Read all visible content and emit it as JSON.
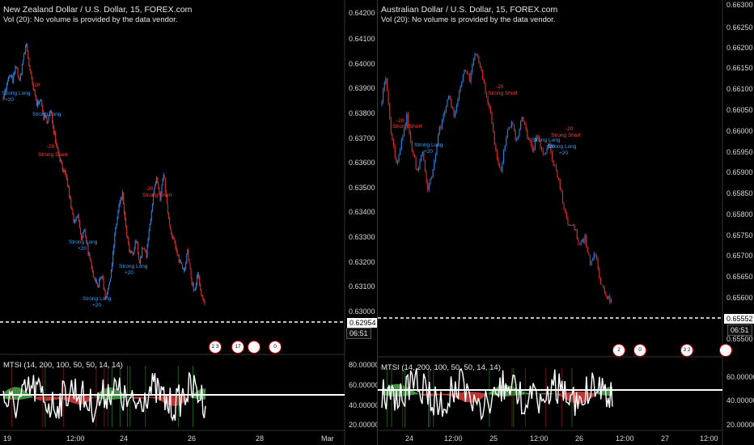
{
  "left": {
    "symbol": "New Zealand Dollar / U.S. Dollar, 15, FOREX.com",
    "volume_note": "Vol (20): No volume is provided by the data vendor.",
    "price_axis": [
      "0.64200",
      "0.64100",
      "0.64000",
      "0.63900",
      "0.63800",
      "0.63700",
      "0.63600",
      "0.63500",
      "0.63400",
      "0.63300",
      "0.63200",
      "0.63100",
      "0.63000"
    ],
    "price_axis_extra": "0",
    "current_price": "0.62954",
    "countdown": "06:51",
    "indicator_title": "MTSI (14, 200, 100, 50, 50, 14, 14)",
    "indicator_axis": [
      "80.00000",
      "60.00000",
      "40.00000",
      "20.00000"
    ],
    "indicator_axis_last": "80.00000",
    "time_axis": [
      "19",
      "12:00",
      "24",
      "26",
      "28",
      "Mar"
    ],
    "events": [
      "2 3",
      "17",
      "",
      "0"
    ],
    "annotations": [
      {
        "text": "-20",
        "kind": "short"
      },
      {
        "text": "Strong Long",
        "kind": "long"
      },
      {
        "text": "+20",
        "kind": "long"
      },
      {
        "text": "Strong Long",
        "kind": "long"
      },
      {
        "text": "-20",
        "kind": "short"
      },
      {
        "text": "Strong Short",
        "kind": "short"
      },
      {
        "text": "-20",
        "kind": "short"
      },
      {
        "text": "Strong Short",
        "kind": "short"
      },
      {
        "text": "Strong Long",
        "kind": "long"
      },
      {
        "text": "+20",
        "kind": "long"
      },
      {
        "text": "Strong Long",
        "kind": "long"
      },
      {
        "text": "+20",
        "kind": "long"
      },
      {
        "text": "Strong Long",
        "kind": "long"
      },
      {
        "text": "+20",
        "kind": "long"
      }
    ]
  },
  "right": {
    "symbol": "Australian Dollar / U.S. Dollar, 15, FOREX.com",
    "volume_note": "Vol (20): No volume is provided by the data vendor.",
    "price_axis": [
      "0.66300",
      "0.66250",
      "0.66200",
      "0.66150",
      "0.66100",
      "0.66050",
      "0.66000",
      "0.65950",
      "0.65900",
      "0.65850",
      "0.65800",
      "0.65750",
      "0.65700",
      "0.65650",
      "0.65600",
      "0.65500"
    ],
    "current_price": "0.65552",
    "countdown": "06:51",
    "indicator_title": "MTSI (14, 200, 100, 50, 50, 14, 14)",
    "indicator_axis": [
      "60.00000",
      "40.00000",
      "20.00000"
    ],
    "time_axis": [
      "24",
      "12:00",
      "25",
      "12:00",
      "26",
      "12:00",
      "27",
      "12:00"
    ],
    "events": [
      "2",
      "0",
      "3 2",
      ""
    ],
    "annotations": [
      {
        "text": "-20",
        "kind": "short"
      },
      {
        "text": "Strong Short",
        "kind": "short"
      },
      {
        "text": "Strong Long",
        "kind": "long"
      },
      {
        "text": "+20",
        "kind": "long"
      },
      {
        "text": "-20",
        "kind": "short"
      },
      {
        "text": "Strong Short",
        "kind": "short"
      },
      {
        "text": "-20",
        "kind": "short"
      },
      {
        "text": "Strong Short",
        "kind": "short"
      },
      {
        "text": "Strong Long",
        "kind": "long"
      },
      {
        "text": "+20",
        "kind": "long"
      },
      {
        "text": "Strong Long",
        "kind": "long"
      },
      {
        "text": "+20",
        "kind": "long"
      }
    ]
  },
  "colors": {
    "up": "#2f7fd9",
    "down": "#d23030",
    "bull_fill": "#4caf50",
    "bear_fill": "#e04040",
    "line": "#ffffff",
    "axis_bg": "#000000"
  },
  "chart_data": [
    {
      "type": "line",
      "title": "New Zealand Dollar / U.S. Dollar, 15, FOREX.com",
      "ylim": [
        0.6288,
        0.6425
      ],
      "series": [
        {
          "values": [
            0.6388,
            0.6392,
            0.6398,
            0.6396,
            0.6402,
            0.6395,
            0.6405,
            0.6412,
            0.64,
            0.6392,
            0.6385,
            0.6388,
            0.638,
            0.6378,
            0.6382,
            0.6374,
            0.6366,
            0.636,
            0.6355,
            0.635,
            0.634,
            0.6332,
            0.6336,
            0.6325,
            0.633,
            0.632,
            0.6312,
            0.6308,
            0.6305,
            0.631,
            0.63,
            0.6304,
            0.6315,
            0.633,
            0.634,
            0.6345,
            0.633,
            0.632,
            0.6318,
            0.6325,
            0.6315,
            0.6322,
            0.6318,
            0.6332,
            0.6345,
            0.6352,
            0.6342,
            0.6355,
            0.634,
            0.633,
            0.6325,
            0.6318,
            0.6315,
            0.6312,
            0.632,
            0.6308,
            0.6302,
            0.631,
            0.63,
            0.6296
          ]
        }
      ]
    },
    {
      "type": "line",
      "title": "Australian Dollar / U.S. Dollar, 15, FOREX.com",
      "ylim": [
        0.6548,
        0.6632
      ],
      "series": [
        {
          "values": [
            0.6608,
            0.6615,
            0.66,
            0.6592,
            0.6598,
            0.6605,
            0.6596,
            0.659,
            0.6595,
            0.6585,
            0.659,
            0.66,
            0.6605,
            0.661,
            0.6605,
            0.6612,
            0.6618,
            0.6615,
            0.6622,
            0.6619,
            0.6612,
            0.6606,
            0.6595,
            0.659,
            0.66,
            0.6603,
            0.6598,
            0.6605,
            0.66,
            0.6596,
            0.66,
            0.6594,
            0.6598,
            0.6592,
            0.6588,
            0.658,
            0.6575,
            0.6575,
            0.657,
            0.6572,
            0.6565,
            0.6568,
            0.656,
            0.6556,
            0.6555
          ]
        }
      ]
    }
  ]
}
